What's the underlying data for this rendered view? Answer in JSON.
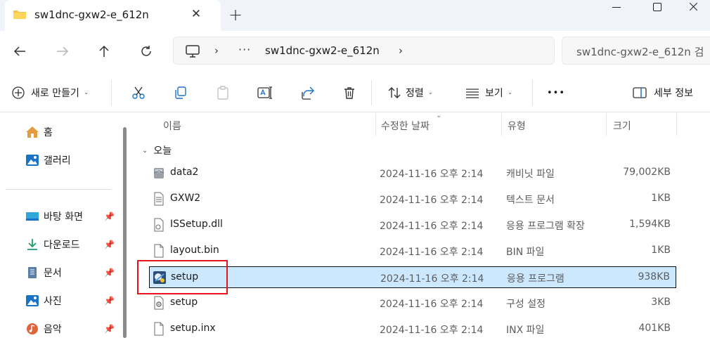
{
  "window": {
    "tab_title": "sw1dnc-gxw2-e_612n",
    "new_tab_symbol": "+",
    "close_symbol": "✕"
  },
  "address": {
    "more": "···",
    "crumb": "sw1dnc-gxw2-e_612n",
    "separator": "›",
    "search_placeholder": "sw1dnc-gxw2-e_612n 검"
  },
  "commands": {
    "new_label": "새로 만들기",
    "sort_label": "정렬",
    "view_label": "보기",
    "more_label": "•••",
    "details_label": "세부 정보"
  },
  "sidebar": {
    "items": [
      {
        "label": "홈",
        "icon": "home-icon"
      },
      {
        "label": "갤러리",
        "icon": "gallery-icon"
      },
      {
        "label": "바탕 화면",
        "icon": "desktop-icon",
        "pinned": true
      },
      {
        "label": "다운로드",
        "icon": "download-icon",
        "pinned": true
      },
      {
        "label": "문서",
        "icon": "document-icon",
        "pinned": true
      },
      {
        "label": "사진",
        "icon": "pictures-icon",
        "pinned": true
      },
      {
        "label": "음악",
        "icon": "music-icon",
        "pinned": true
      }
    ]
  },
  "columns": {
    "name": "이름",
    "date": "수정한 날짜",
    "type": "유형",
    "size": "크기"
  },
  "group": {
    "label": "오늘"
  },
  "files": [
    {
      "name": "data2",
      "date": "2024-11-16 오후 2:14",
      "type": "캐비닛 파일",
      "size": "79,002KB",
      "icon": "cabinet-icon"
    },
    {
      "name": "GXW2",
      "date": "2024-11-16 오후 2:14",
      "type": "텍스트 문서",
      "size": "1KB",
      "icon": "text-file-icon"
    },
    {
      "name": "ISSetup.dll",
      "date": "2024-11-16 오후 2:14",
      "type": "응용 프로그램 확장",
      "size": "1,594KB",
      "icon": "dll-icon"
    },
    {
      "name": "layout.bin",
      "date": "2024-11-16 오후 2:14",
      "type": "BIN 파일",
      "size": "1KB",
      "icon": "file-icon"
    },
    {
      "name": "setup",
      "date": "2024-11-16 오후 2:14",
      "type": "응용 프로그램",
      "size": "938KB",
      "icon": "setup-app-icon",
      "selected": true
    },
    {
      "name": "setup",
      "date": "2024-11-16 오후 2:14",
      "type": "구성 설정",
      "size": "3KB",
      "icon": "config-file-icon"
    },
    {
      "name": "setup.inx",
      "date": "2024-11-16 오후 2:14",
      "type": "INX 파일",
      "size": "401KB",
      "icon": "file-icon"
    }
  ],
  "colors": {
    "selection_bg": "#cce8ff",
    "highlight": "#e8141c",
    "folder": "#f6c343",
    "accent": "#1a73c8"
  }
}
